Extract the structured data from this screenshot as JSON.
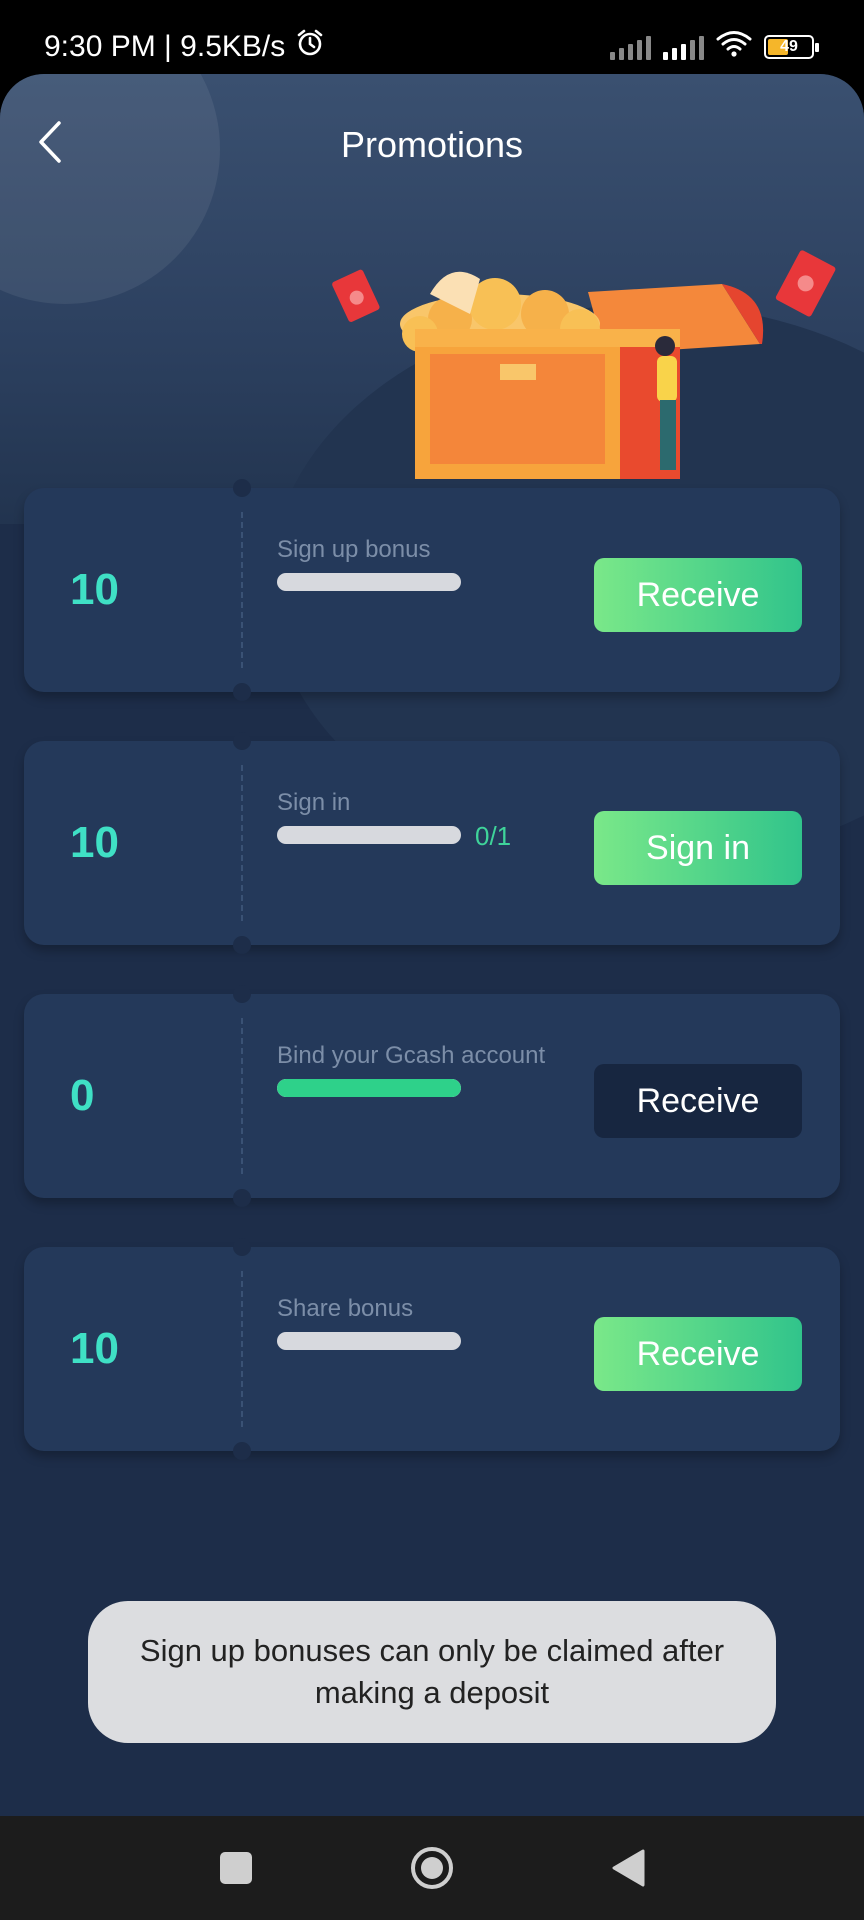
{
  "status_bar": {
    "time_speed": "9:30 PM | 9.5KB/s",
    "battery": "49"
  },
  "header": {
    "title": "Promotions"
  },
  "promotions": [
    {
      "amount": "10",
      "label": "Sign up bonus",
      "progress": 0.0,
      "progress_text": "",
      "action": "Receive",
      "action_style": "green"
    },
    {
      "amount": "10",
      "label": "Sign in",
      "progress": 0.0,
      "progress_text": "0/1",
      "action": "Sign in",
      "action_style": "green"
    },
    {
      "amount": "0",
      "label": "Bind your Gcash account",
      "progress": 1.0,
      "progress_text": "",
      "action": "Receive",
      "action_style": "dark"
    },
    {
      "amount": "10",
      "label": "Share bonus",
      "progress": 0.0,
      "progress_text": "",
      "action": "Receive",
      "action_style": "green"
    }
  ],
  "toast": {
    "message": "Sign up bonuses can only be claimed after making a deposit"
  },
  "colors": {
    "accent": "#3fe0c5",
    "button_green": "#31c48b",
    "background": "#1d2d49"
  }
}
